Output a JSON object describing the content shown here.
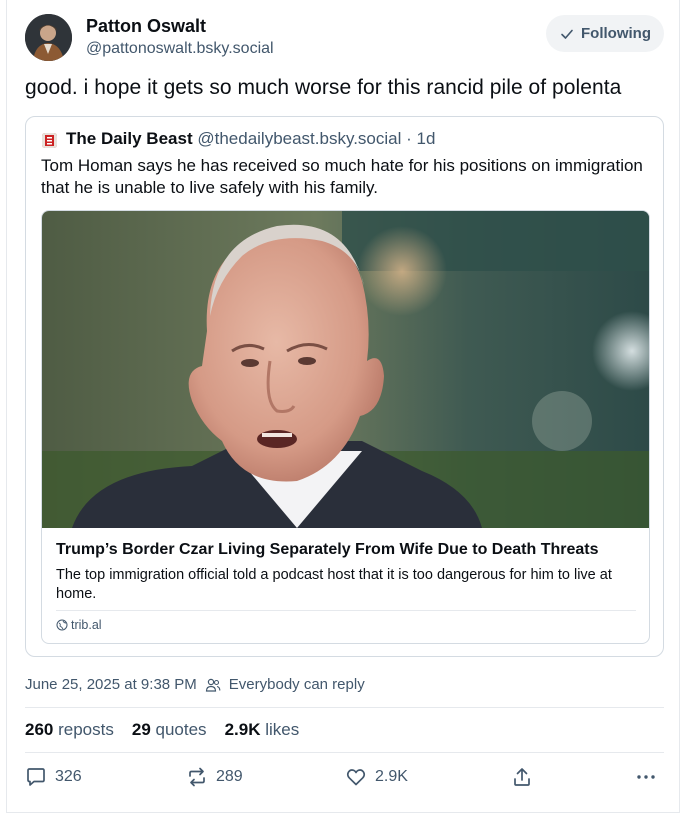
{
  "author": {
    "name": "Patton Oswalt",
    "handle": "@pattonoswalt.bsky.social"
  },
  "follow_button": {
    "label": "Following",
    "icon": "check-icon"
  },
  "post": {
    "text": "good. i hope it gets so much worse for this rancid pile of polenta",
    "timestamp": "June 25, 2025 at 9:38 PM",
    "reply_setting": "Everybody can reply"
  },
  "quoted_post": {
    "author_name": "The Daily Beast",
    "author_handle": "@thedailybeast.bsky.social",
    "age": "· 1d",
    "text": "Tom Homan says he has received so much hate for his positions on immigration that he is unable to live safely with his family.",
    "link_card": {
      "title": "Trump’s Border Czar Living Separately From Wife Due to Death Threats",
      "description": "The top immigration official told a podcast host that it is too dangerous for him to live at home.",
      "domain": "trib.al"
    }
  },
  "stats": {
    "reposts_count": "260",
    "reposts_label": "reposts",
    "quotes_count": "29",
    "quotes_label": "quotes",
    "likes_count": "2.9K",
    "likes_label": "likes"
  },
  "actions": {
    "reply_count": "326",
    "repost_count": "289",
    "like_count": "2.9K"
  },
  "colors": {
    "muted_text": "#42576c",
    "border": "#d4dbe2",
    "button_bg": "#f1f3f5"
  }
}
